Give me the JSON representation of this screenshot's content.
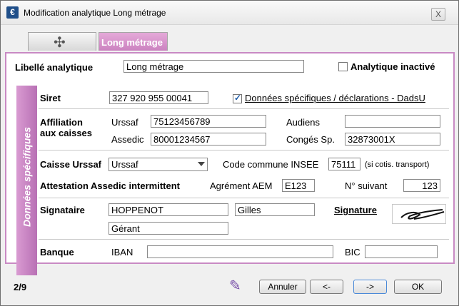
{
  "window": {
    "title": "Modification analytique Long métrage",
    "close": "X"
  },
  "tabs": [
    {
      "label": "",
      "icon": "tool-icon"
    },
    {
      "label": "Long métrage"
    }
  ],
  "libelle": {
    "label": "Libellé analytique",
    "value": "Long métrage"
  },
  "inactive": {
    "label": "Analytique inactivé",
    "checked": false
  },
  "side_title": "Données spécifiques",
  "siret": {
    "label": "Siret",
    "value": "327 920 955 00041"
  },
  "dadsu": {
    "label": "Données spécifiques / déclarations - DadsU",
    "checked": true
  },
  "affiliation": {
    "label_line1": "Affiliation",
    "label_line2": "aux caisses",
    "urssaf_label": "Urssaf",
    "urssaf_value": "75123456789",
    "assedic_label": "Assedic",
    "assedic_value": "80001234567",
    "audiens_label": "Audiens",
    "audiens_value": "",
    "conges_label": "Congés Sp.",
    "conges_value": "32873001X"
  },
  "caisse": {
    "label": "Caisse Urssaf",
    "value": "Urssaf",
    "insee_label": "Code commune INSEE",
    "insee_value": "75111",
    "note": "(si cotis. transport)"
  },
  "attestation": {
    "label": "Attestation Assedic intermittent",
    "aem_label": "Agrément AEM",
    "aem_value": "E123",
    "next_label": "N° suivant",
    "next_value": "123"
  },
  "signataire": {
    "label": "Signataire",
    "last_name": "HOPPENOT",
    "first_name": "Gilles",
    "role": "Gérant",
    "signature_label": "Signature"
  },
  "bank": {
    "label": "Banque",
    "iban_label": "IBAN",
    "iban_value": "",
    "bic_label": "BIC",
    "bic_value": ""
  },
  "footer": {
    "page": "2/9",
    "cancel": "Annuler",
    "prev": "<-",
    "next": "->",
    "ok": "OK",
    "edit_icon": "pencil-icon"
  }
}
